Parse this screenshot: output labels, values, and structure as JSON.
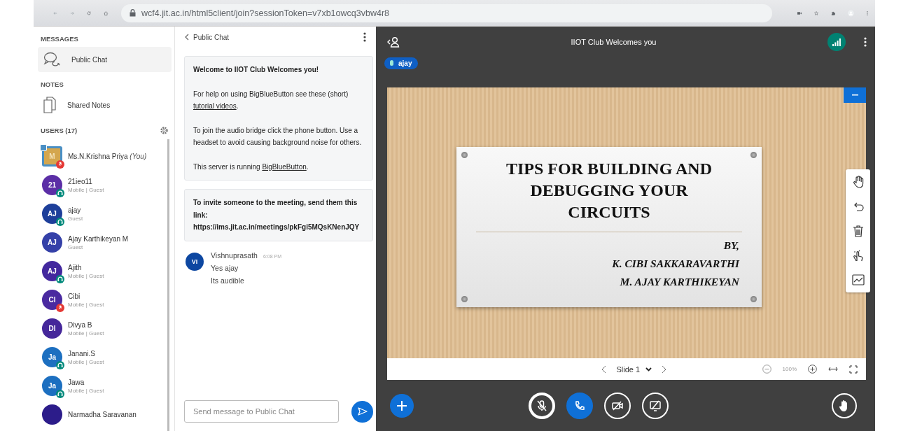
{
  "browser": {
    "url": "wcf4.jit.ac.in/html5client/join?sessionToken=v7xb1owcq3vbw4r8"
  },
  "sidebar": {
    "messages_heading": "MESSAGES",
    "messages": [
      {
        "label": "Public Chat",
        "selected": true
      }
    ],
    "notes_heading": "NOTES",
    "notes": [
      {
        "label": "Shared Notes",
        "selected": false
      }
    ],
    "users_heading": "USERS (17)",
    "users": [
      {
        "name": "Ms.N.Krishna Priya",
        "you": "(You)",
        "initials": "M",
        "color": "#d4a64e",
        "moderator": true,
        "muted": true,
        "listen_only": false
      },
      {
        "name": "21ieo11",
        "subtitle": "Mobile | Guest",
        "initials": "21",
        "color": "#5b2ea6",
        "moderator": false,
        "muted": false,
        "listen_only": true
      },
      {
        "name": "ajay",
        "subtitle": "Guest",
        "initials": "AJ",
        "color": "#1e3f9a",
        "moderator": false,
        "muted": false,
        "listen_only": true
      },
      {
        "name": "Ajay Karthikeyan M",
        "subtitle": "Guest",
        "initials": "AJ",
        "color": "#3440a8",
        "moderator": false,
        "muted": false,
        "listen_only": false
      },
      {
        "name": "Ajith",
        "subtitle": "Mobile | Guest",
        "initials": "AJ",
        "color": "#43289e",
        "moderator": false,
        "muted": false,
        "listen_only": true
      },
      {
        "name": "Cibi",
        "subtitle": "Mobile | Guest",
        "initials": "CI",
        "color": "#4a2aa0",
        "moderator": false,
        "muted": true,
        "listen_only": false
      },
      {
        "name": "Divya B",
        "subtitle": "Mobile | Guest",
        "initials": "DI",
        "color": "#45279a",
        "moderator": false,
        "muted": false,
        "listen_only": false
      },
      {
        "name": "Janani.S",
        "subtitle": "Mobile | Guest",
        "initials": "Ja",
        "color": "#1c6fc0",
        "moderator": false,
        "muted": false,
        "listen_only": true
      },
      {
        "name": "Jawa",
        "subtitle": "Mobile | Guest",
        "initials": "Ja",
        "color": "#1c6fc0",
        "moderator": false,
        "muted": false,
        "listen_only": true
      },
      {
        "name": "Narmadha Saravanan",
        "color": "#2c1c8a",
        "moderator": false,
        "muted": false,
        "listen_only": false
      }
    ]
  },
  "chat": {
    "title": "Public Chat",
    "welcome": {
      "heading": "Welcome to IIOT Club Welcomes you!",
      "paragraphs": [
        {
          "text": "For help on using BigBlueButton see these (short) ",
          "link": "tutorial videos",
          "after": "."
        },
        {
          "text": "To join the audio bridge click the phone button. Use a headset to avoid causing background noise for others."
        },
        {
          "text": "This server is running ",
          "link": "BigBlueButton",
          "after": "."
        }
      ]
    },
    "invite": "To invite someone to the meeting, send them this link: https://ims.jit.ac.in/meetings/pkFgi5MQsKNenJQY",
    "messages": [
      {
        "initials": "VI",
        "color": "#0d47a1",
        "sender": "Vishnuprasath",
        "time": "6:08 PM",
        "lines": [
          "Yes ajay",
          "Its audible"
        ]
      }
    ],
    "input": {
      "placeholder": "Send message to Public Chat"
    }
  },
  "presentation": {
    "title": "IIOT Club Welcomes you",
    "presenter": "ajay",
    "slide": {
      "title": "TIPS FOR BUILDING AND DEBUGGING YOUR CIRCUITS",
      "by": "BY,",
      "authors": [
        "K. CIBI SAKKARAVARTHI",
        "M. AJAY KARTHIKEYAN"
      ]
    },
    "slide_label": "Slide 1",
    "zoom": "100%"
  },
  "actions": {
    "muted": true,
    "audio_joined": true,
    "video_on": false,
    "sharing": false
  }
}
